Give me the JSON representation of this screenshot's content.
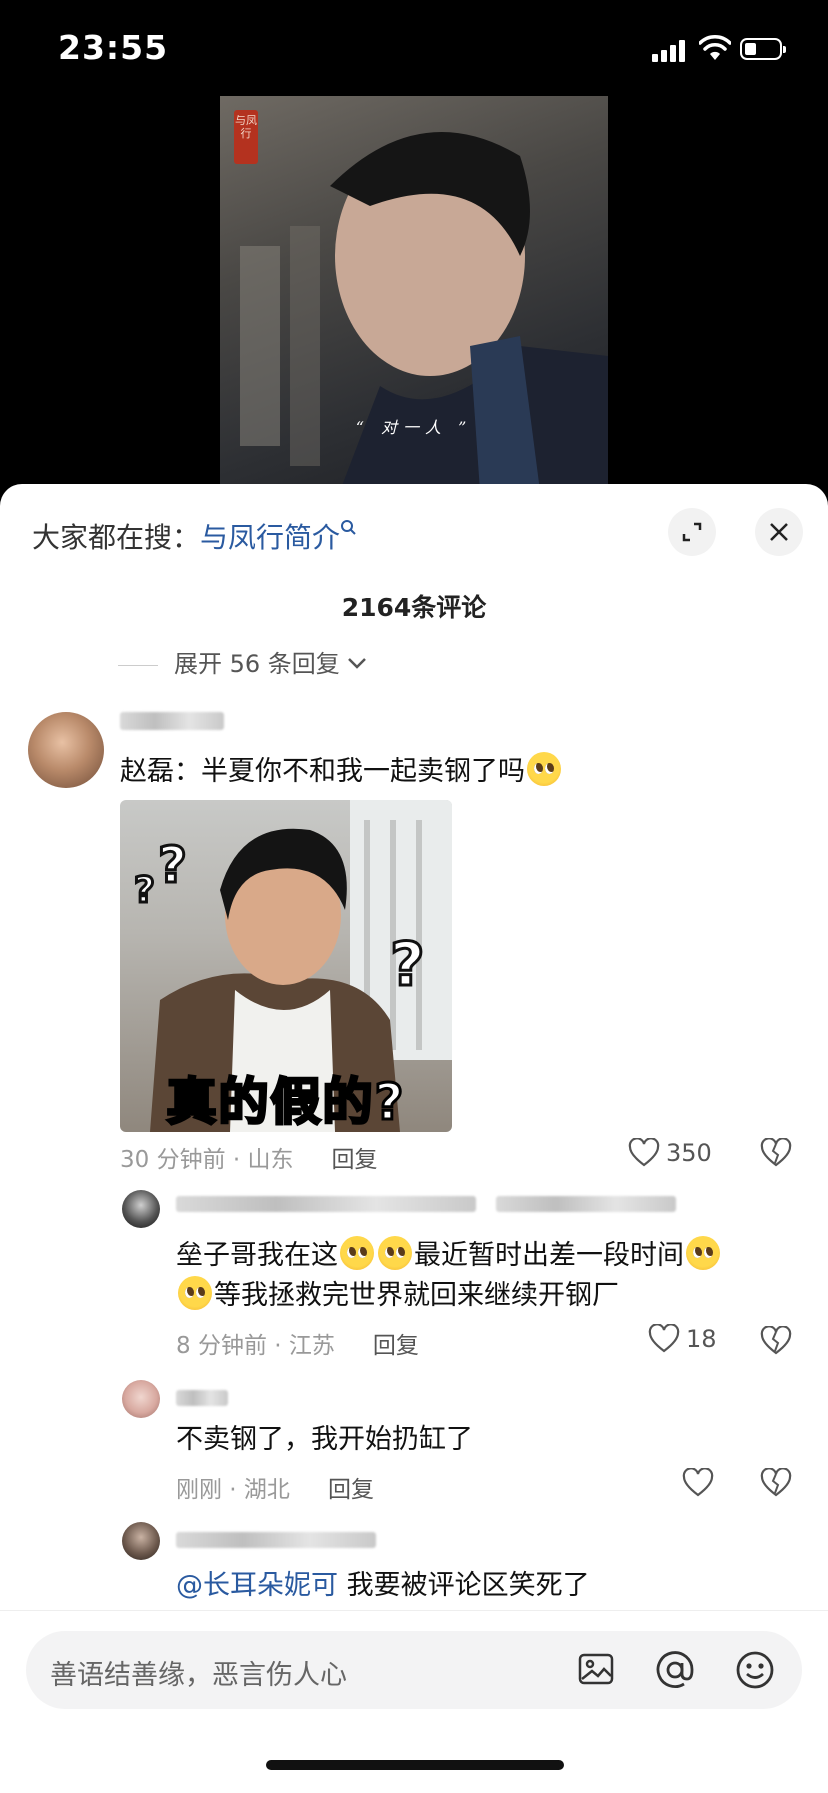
{
  "status_bar": {
    "time": "23:55"
  },
  "video": {
    "seal_text": "与凤行",
    "caption": "“ 对一人 ”"
  },
  "panel": {
    "search_prefix": "大家都在搜：",
    "search_keyword": "与凤行简介",
    "comment_count": "2164条评论",
    "expand_replies": "展开 56 条回复"
  },
  "comments": [
    {
      "text": "赵磊：半夏你不和我一起卖钢了吗",
      "meme_caption": "真的假的?",
      "meta": "30 分钟前 · 山东",
      "reply_label": "回复",
      "likes": "350"
    },
    {
      "line1": "垒子哥我在这",
      "line1b": "最近暂时出差一段时间",
      "line2": "等我拯救完世界就回来继续开钢厂",
      "meta": "8 分钟前 · 江苏",
      "reply_label": "回复",
      "likes": "18"
    },
    {
      "text": "不卖钢了，我开始扔缸了",
      "meta": "刚刚 · 湖北",
      "reply_label": "回复"
    },
    {
      "mention": "@长耳朵妮可",
      "text": " 我要被评论区笑死了"
    }
  ],
  "input": {
    "placeholder": "善语结善缘，恶言伤人心"
  },
  "icons": {
    "expand": "expand-icon",
    "close": "close-icon",
    "like": "heart-icon",
    "dislike": "broken-heart-icon",
    "image": "image-icon",
    "at": "at-icon",
    "emoji": "emoji-icon"
  }
}
